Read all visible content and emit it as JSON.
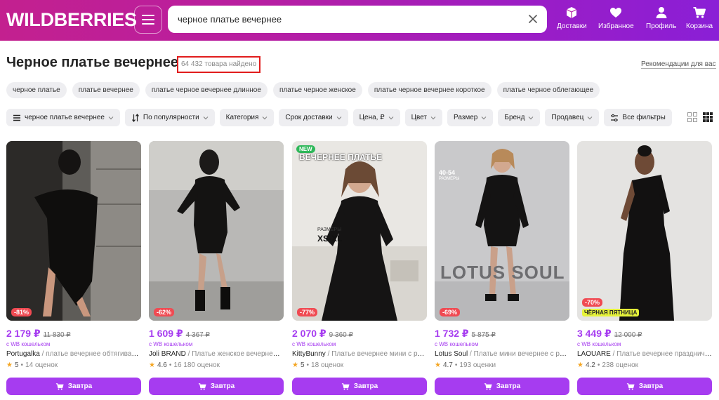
{
  "header": {
    "logo": "WILDBERRIES",
    "search_value": "черное платье вечернее",
    "nav": [
      {
        "label": "Доставки",
        "icon": "box-icon"
      },
      {
        "label": "Избранное",
        "icon": "heart-icon"
      },
      {
        "label": "Профиль",
        "icon": "user-icon"
      },
      {
        "label": "Корзина",
        "icon": "cart-icon"
      }
    ]
  },
  "page": {
    "title": "Черное платье вечернее",
    "count": "64 432 товара найдено",
    "recommend": "Рекомендации для вас"
  },
  "chips": [
    "черное платье",
    "платье вечернее",
    "платье черное вечернее длинное",
    "платье черное женское",
    "платье черное вечернее короткое",
    "платье черное облегающее"
  ],
  "filters": {
    "query": "черное платье вечернее",
    "sort": "По популярности",
    "category": "Категория",
    "delivery": "Срок доставки",
    "price": "Цена, ₽",
    "color": "Цвет",
    "size": "Размер",
    "brand": "Бренд",
    "seller": "Продавец",
    "all": "Все фильтры"
  },
  "products": [
    {
      "price": "2 179 ₽",
      "old_price": "11 830 ₽",
      "wallet": "с WB кошельком",
      "brand": "Portugalka",
      "desc": " / платье вечернее обтягивающ…",
      "rating": "5",
      "reviews": "14 оценок",
      "discount": "-81%",
      "buy_label": "Завтра"
    },
    {
      "price": "1 609 ₽",
      "old_price": "4 367 ₽",
      "wallet": "с WB кошельком",
      "brand": "Joli BRAND",
      "desc": " / Платье женское вечернее н…",
      "rating": "4.6",
      "reviews": "16 180 оценок",
      "discount": "-62%",
      "buy_label": "Завтра"
    },
    {
      "price": "2 070 ₽",
      "old_price": "9 360 ₽",
      "wallet": "с WB кошельком",
      "brand": "KittyBunny",
      "desc": " / Платье вечернее мини с рук…",
      "rating": "5",
      "reviews": "18 оценок",
      "discount": "-77%",
      "buy_label": "Завтра",
      "badge": "NEW",
      "overlay_title": "ВЕЧЕРНЕЕ ПЛАТЬЕ",
      "overlay_sizes_label": "РАЗМЕРЫ",
      "overlay_sizes": "XS-XL"
    },
    {
      "price": "1 732 ₽",
      "old_price": "5 875 ₽",
      "wallet": "с WB кошельком",
      "brand": "Lotus Soul",
      "desc": " / Платье мини вечернее с раз…",
      "rating": "4.7",
      "reviews": "193 оценки",
      "discount": "-69%",
      "buy_label": "Завтра",
      "overlay_sizes": "40-54",
      "overlay_sizes_label": "РАЗМЕРЫ",
      "overlay_brand": "LOTUS SOUL"
    },
    {
      "price": "3 449 ₽",
      "old_price": "12 000 ₽",
      "wallet": "с WB кошельком",
      "brand": "LAOUARE",
      "desc": " / Платье вечернее празднично…",
      "rating": "4.2",
      "reviews": "238 оценок",
      "discount": "-70%",
      "buy_label": "Завтра",
      "promo": "ЧЁРНАЯ ПЯТНИЦА"
    }
  ],
  "colors": {
    "accent": "#a63cf0",
    "discount": "#f04a52",
    "header_start": "#c3208f",
    "header_end": "#8a1fd6"
  }
}
